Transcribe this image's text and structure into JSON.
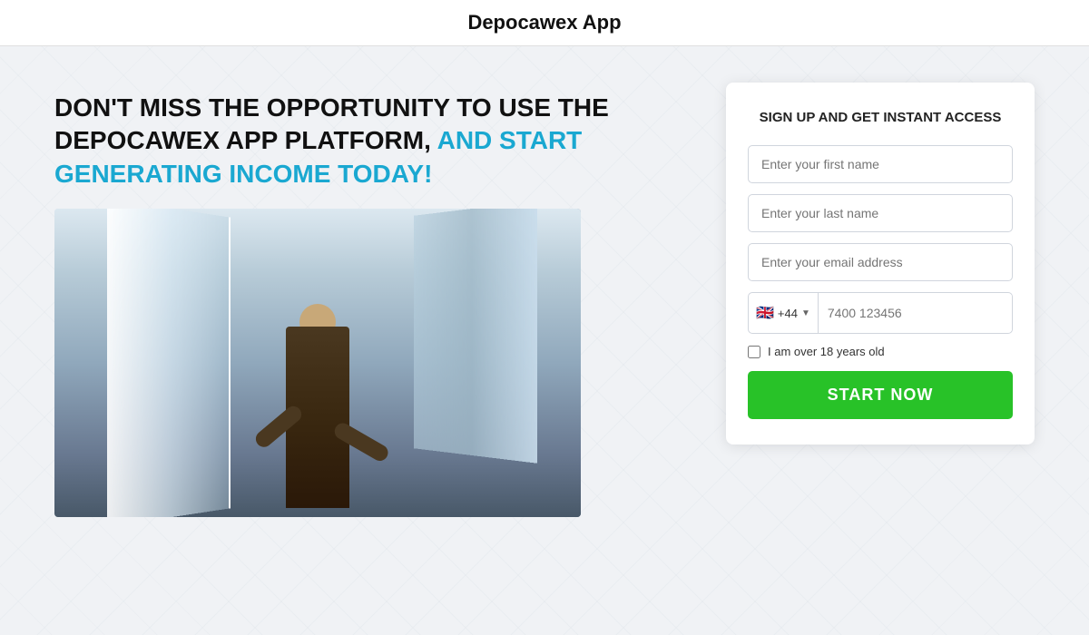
{
  "header": {
    "title": "Depocawex App"
  },
  "left": {
    "headline_part1": "DON'T MISS THE OPPORTUNITY TO USE THE DEPOCAWEX APP PLATFORM, ",
    "headline_highlight": "AND START GENERATING INCOME TODAY!"
  },
  "form": {
    "title": "SIGN UP AND GET INSTANT ACCESS",
    "first_name_placeholder": "Enter your first name",
    "last_name_placeholder": "Enter your last name",
    "email_placeholder": "Enter your email address",
    "phone_country_code": "+44",
    "phone_placeholder": "7400 123456",
    "checkbox_label": "I am over 18 years old",
    "submit_label": "START NOW"
  }
}
